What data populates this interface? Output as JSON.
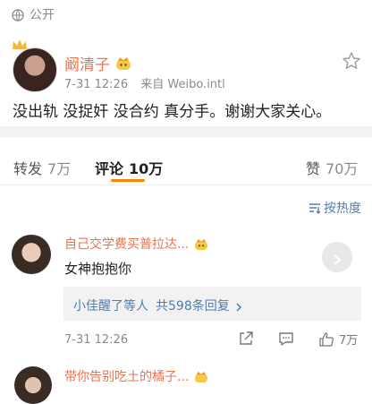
{
  "visibility": {
    "label": "公开"
  },
  "post": {
    "author": "阚清子",
    "time": "7-31 12:26",
    "source": "来自 Weibo.intl",
    "text": "没出轨 没捉奸 没合约 真分手。谢谢大家关心。"
  },
  "tabs": {
    "repost": {
      "label": "转发",
      "count": "7万"
    },
    "comment": {
      "label": "评论",
      "count": "10万"
    },
    "like": {
      "label": "赞",
      "count": "70万"
    }
  },
  "sort": {
    "label": "按热度"
  },
  "comments": [
    {
      "author": "自己交学费买普拉达...",
      "text": "女神抱抱你",
      "reply_user": "小佳醒了等人",
      "reply_count": "共598条回复",
      "time": "7-31 12:26",
      "like_count": "7万"
    },
    {
      "author": "带你告别吃土的橘子..."
    }
  ],
  "colors": {
    "accent": "#eb7350",
    "link": "#507daf",
    "tab_underline": "#ff8200"
  }
}
